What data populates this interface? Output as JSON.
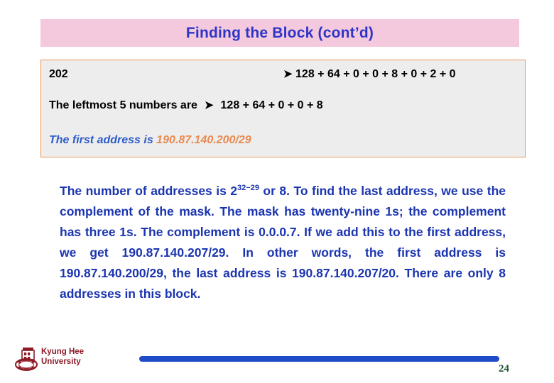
{
  "slide": {
    "title": "Finding the Block (cont’d)",
    "page_number": "24"
  },
  "content_box": {
    "row_decimal": {
      "value": "202",
      "arrow": "arrow-right-icon",
      "expansion": "128 + 64 + 0 + 0 + 8 + 0 + 2 + 0"
    },
    "row_leftmost": {
      "label": "The leftmost 5 numbers are",
      "arrow": "arrow-right-icon",
      "expansion": "128 + 64 + 0 + 0 + 8"
    },
    "row_first_address": {
      "label": "The first address is",
      "value": "190.87.140.200/29"
    }
  },
  "body": {
    "part1": "The number of addresses is 2",
    "exponent": "32−29",
    "part2": " or 8. To find the last address, we use the complement of the mask. The mask has twenty-nine 1s; the complement has three 1s. The complement is 0.0.0.7. If we add this to the first address, we get 190.87.140.207/29. In other words, the first address is 190.87.140.200/29, the last address is 190.87.140.207/20. There are only 8 addresses in this block."
  },
  "footer": {
    "logo_icon": "kyung-hee-crest-icon",
    "university_name": "Kyung Hee\nUniversity"
  },
  "colors": {
    "title_banner_bg": "#f4c8dd",
    "title_text": "#2d35c8",
    "box_border": "#e8965a",
    "box_bg": "#ededed",
    "body_text": "#1b35b0",
    "accent_orange": "#e98a50",
    "footer_bar": "#1e4bc8",
    "logo_maroon": "#8c1b26",
    "page_number": "#1e5430"
  }
}
